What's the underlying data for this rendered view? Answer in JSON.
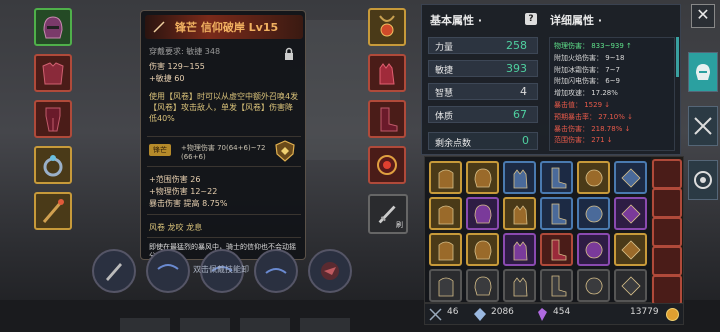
{
  "tooltip": {
    "name": "锋芒 信仰破岸 Lv15",
    "requirement": "穿戴要求:  敏捷 348",
    "damage": "伤害  129~155",
    "agility": "+敏捷 60",
    "description": "使用【风卷】时可以从虚空中额外召唤4发【风卷】攻击敌人，单发【风卷】伤害降低40%",
    "gem_tag": "锋芒",
    "gem_line1": "+物理伤害 70(64+6)~72",
    "gem_line2": "(66+6)",
    "range": "+范围伤害 26",
    "phys": "+物理伤害 12~22",
    "crit": "暴击伤害 提高 8.75%",
    "skills": "风卷   龙咬   龙息",
    "lore": "即使在最猛烈的暴风中，骑士的信仰也不会动摇分毫"
  },
  "hint_text": "双击佩戴技能卸",
  "brush_label": "刷",
  "basic": {
    "title": "基本属性 ·",
    "stats": [
      {
        "label": "力量",
        "value": "258",
        "color": "green"
      },
      {
        "label": "敏捷",
        "value": "393",
        "color": "green"
      },
      {
        "label": "智慧",
        "value": "4",
        "color": "white"
      },
      {
        "label": "体质",
        "value": "67",
        "color": "green"
      }
    ],
    "points_label": "剩余点数",
    "points_value": "0"
  },
  "detail": {
    "title": "详细属性 ·",
    "lines": [
      {
        "text": "物理伤害： 833~939 ↑",
        "color": "g"
      },
      {
        "text": "附加火焰伤害： 9~18",
        "color": "w"
      },
      {
        "text": "附加冰霜伤害： 7~7",
        "color": "w"
      },
      {
        "text": "附加闪电伤害： 6~9",
        "color": "w"
      },
      {
        "text": "增加攻速： 17.28%",
        "color": "w"
      },
      {
        "text": "暴击值： 1529 ↓",
        "color": "r"
      },
      {
        "text": "预期暴击率： 27.10% ↓",
        "color": "r"
      },
      {
        "text": "暴击伤害： 218.78% ↓",
        "color": "r"
      },
      {
        "text": "范围伤害： 271 ↓",
        "color": "r"
      }
    ]
  },
  "bottom": {
    "count": "46",
    "currency1": "2086",
    "currency2": "454",
    "gold": "13779"
  },
  "colors": {
    "accent": "#2ba0a0",
    "green": "#4fd0a0",
    "red": "#e85a4a"
  }
}
